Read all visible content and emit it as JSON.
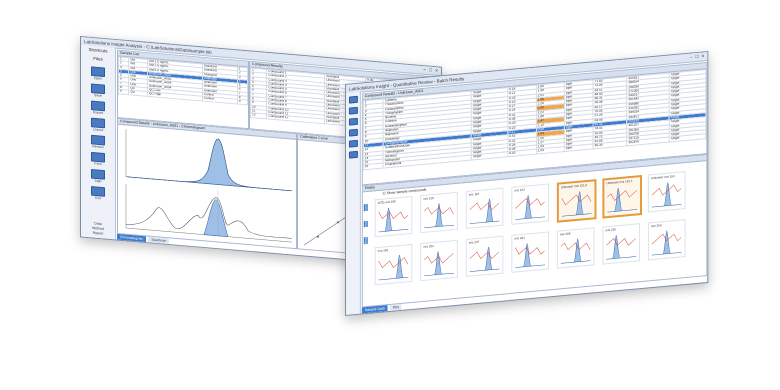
{
  "back_window": {
    "title": "LabSolutions Insight Analysis - C:\\LabSolutions\\Data\\sample.lsb",
    "rail_header": "Shortcuts",
    "rail_sub": "Files",
    "rail_items": [
      "Open",
      "Save",
      "Export",
      "Layout",
      "Review",
      "Print",
      "Sign",
      "Exit"
    ],
    "rail_footer": [
      "Data",
      "Method",
      "Report"
    ],
    "table1_header": "Sample List",
    "table1_rows": [
      [
        "1",
        "Std",
        "Std 1.0 ng/mL",
        "Standard",
        "1"
      ],
      [
        "2",
        "Std",
        "Std 2.0 ng/mL",
        "Standard",
        "2"
      ],
      [
        "3",
        "Std",
        "Std 5.0 ng/mL",
        "Standard",
        "3"
      ],
      [
        "4",
        "Unk",
        "Unknown_A001",
        "Unknown",
        "4"
      ],
      [
        "5",
        "Unk",
        "Unknown_A002",
        "Unknown",
        "5"
      ],
      [
        "6",
        "Unk",
        "Unknown_A003",
        "Unknown",
        "6"
      ],
      [
        "7",
        "Unk",
        "Unknown_A004",
        "Unknown",
        "7"
      ],
      [
        "8",
        "QC",
        "QC Low",
        "Control",
        "8"
      ],
      [
        "9",
        "QC",
        "QC High",
        "Control",
        "9"
      ]
    ],
    "table2_header": "Compound Results",
    "table2_rows": [
      [
        "1",
        "Compound 1",
        "Standard",
        "0.00",
        "1.00",
        "12.34"
      ],
      [
        "2",
        "Compound 2",
        "Unknown",
        "1.23",
        "2.50",
        "23.45"
      ],
      [
        "3",
        "Compound 3",
        "Unknown",
        "0.85",
        "1.74",
        "11.02"
      ],
      [
        "4",
        "Compound 4",
        "Standard",
        "2.41",
        "5.12",
        "40.10"
      ],
      [
        "5",
        "Compound 5",
        "Unknown",
        "1.02",
        "2.05",
        "18.73"
      ],
      [
        "6",
        "Compound 6",
        "Unknown",
        "0.44",
        "0.98",
        "7.65"
      ],
      [
        "7",
        "Compound 7",
        "Standard",
        "3.10",
        "6.22",
        "52.41"
      ],
      [
        "8",
        "Compound 8",
        "Unknown",
        "0.66",
        "1.31",
        "9.88"
      ],
      [
        "9",
        "Compound 9",
        "Unknown",
        "1.75",
        "3.44",
        "26.19"
      ],
      [
        "10",
        "Compound 10",
        "Unknown",
        "0.93",
        "1.88",
        "14.07"
      ],
      [
        "11",
        "Compound 11",
        "Standard",
        "2.20",
        "4.45",
        "36.90"
      ],
      [
        "12",
        "Compound 12",
        "Unknown",
        "0.51",
        "1.03",
        "8.12"
      ]
    ],
    "chart_header": "Compound Details - Unknown_A001 - Chromatogram",
    "cal_header": "Calibration Curve",
    "tabs": [
      "Chromatogram",
      "Spectrum"
    ]
  },
  "front_window": {
    "title": "LabSolutions Insight - Quantitative Review - Batch Results",
    "rail_header": "Shortcuts",
    "rail_items": [
      "Open",
      "Save",
      "Review",
      "Export",
      "Report",
      "Close"
    ],
    "table_header": "Compound Results - Unknown_A001",
    "rows": [
      [
        "1",
        "Caffeine",
        "Target",
        "0.18",
        "1.60",
        "ppm",
        "71.60",
        "425521",
        "Target"
      ],
      [
        "2",
        "Theobromine",
        "Target",
        "0.21",
        "1.58",
        "ppm",
        "72.04",
        "388104",
        "Target"
      ],
      [
        "3",
        "Paraxanthine",
        "Target",
        "0.33",
        "2.01",
        "ppm",
        "54.11",
        "298330",
        "Target"
      ],
      [
        "4",
        "Theophylline",
        "Target",
        "0.19",
        "1.36",
        "ppm",
        "48.90",
        "271005",
        "Target"
      ],
      [
        "5",
        "Nicotine",
        "Target",
        "0.27",
        "1.20",
        "ppm",
        "66.31",
        "340217",
        "Target"
      ],
      [
        "6",
        "Cotinine",
        "Target",
        "0.14",
        "0.95",
        "ppm",
        "59.48",
        "301442",
        "Target"
      ],
      [
        "7",
        "Acetaminophen",
        "Target",
        "0.41",
        "2.22",
        "ppm",
        "62.17",
        "356980",
        "Target"
      ],
      [
        "8",
        "Ibuprofen",
        "Target",
        "0.36",
        "1.88",
        "ppm",
        "70.05",
        "410332",
        "Target"
      ],
      [
        "9",
        "Naproxen",
        "Target",
        "0.29",
        "1.47",
        "ppm",
        "57.26",
        "289014",
        "Target"
      ],
      [
        "10",
        "Diclofenac",
        "Target",
        "0.23",
        "1.12",
        "ppm",
        "63.90",
        "332871",
        "Target"
      ],
      [
        "11",
        "Carbamazepine",
        "Target",
        "0.17",
        "0.88",
        "ppm",
        "45.33",
        "254190",
        "Target"
      ],
      [
        "12",
        "Sulfamethoxazole",
        "Target",
        "0.52",
        "2.64",
        "ppm",
        "78.41",
        "451227",
        "Target"
      ],
      [
        "13",
        "Trimethoprim",
        "Target",
        "0.31",
        "1.55",
        "ppm",
        "52.09",
        "281355",
        "Target"
      ],
      [
        "14",
        "Atenolol",
        "Target",
        "0.26",
        "1.27",
        "ppm",
        "49.72",
        "266708",
        "Target"
      ],
      [
        "15",
        "Metoprolol",
        "Target",
        "0.38",
        "1.93",
        "ppm",
        "61.85",
        "347119",
        "Target"
      ],
      [
        "16",
        "Propranolol",
        "Target",
        "0.20",
        "1.04",
        "ppm",
        "56.30",
        "301876",
        "Target"
      ]
    ],
    "grid_header": "Peaks",
    "grid_toolbar": "Show sample compounds",
    "thumb_titles": [
      "ISTD m/z 195",
      "m/z 138",
      "m/z 110",
      "m/z 152",
      "Unknown m/z 151.0",
      "Unknown m/z 181.1",
      "Unknown m/z 163",
      "m/z 265",
      "m/z 253",
      "m/z 237",
      "m/z 291",
      "m/z 268",
      "m/z 226",
      "m/z 260"
    ],
    "highlight_indices": [
      4,
      5
    ],
    "tabs": [
      "Sample Data",
      "Plot"
    ],
    "side_labels": [
      "Conc",
      "Area",
      "Resp"
    ]
  },
  "colors": {
    "accent_blue": "#3d7bd0",
    "highlight_orange": "#f0a64a",
    "trace_red": "#d94a3a",
    "peak_blue": "#2f5fa8",
    "peak_fill": "#9fc0e6"
  }
}
